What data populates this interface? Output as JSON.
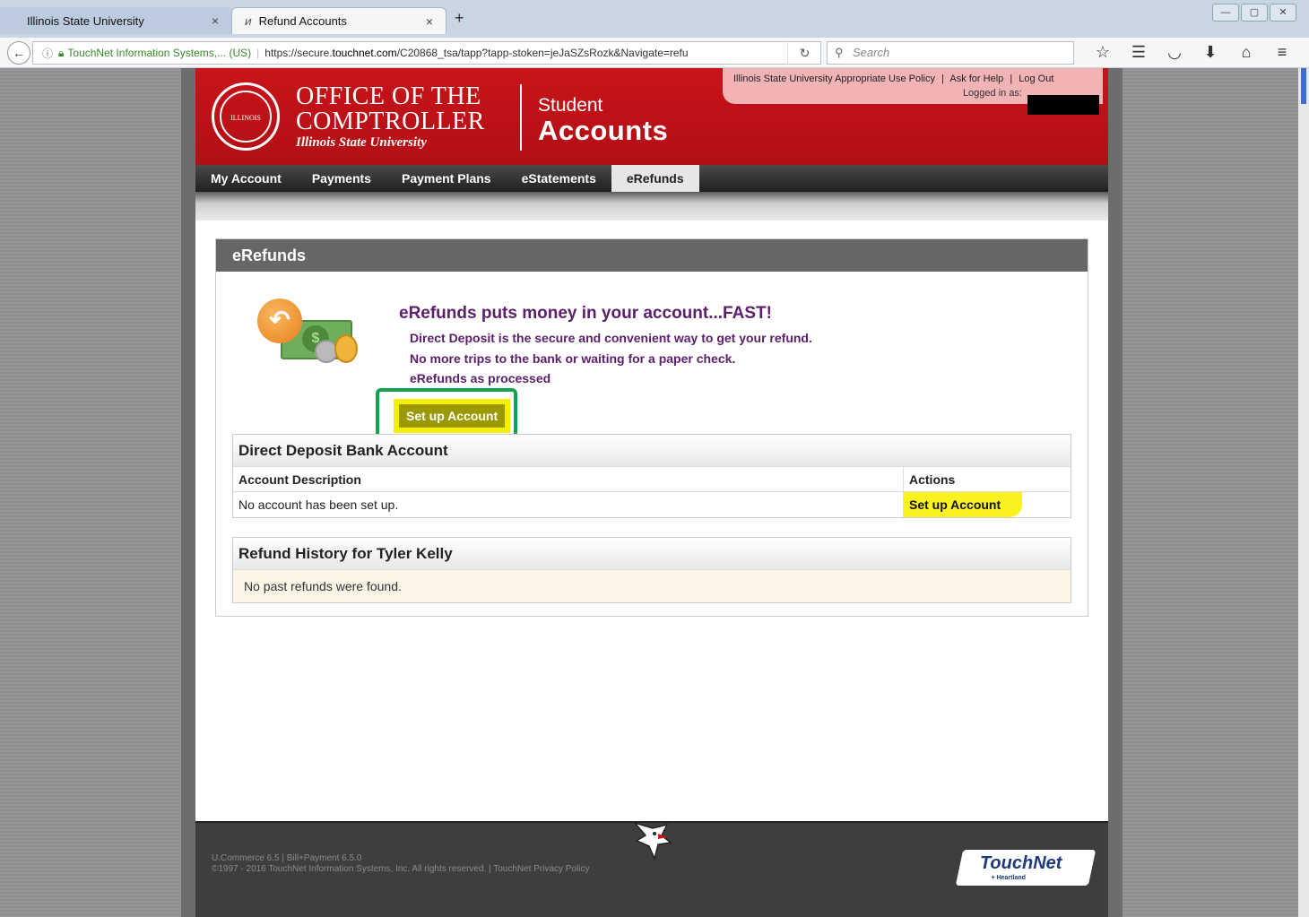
{
  "browser": {
    "tabs": [
      {
        "label": "Illinois State University",
        "active": false
      },
      {
        "label": "Refund Accounts",
        "active": true
      }
    ],
    "url_site": "TouchNet Information Systems,... (US)",
    "url_prefix": "https://secure.",
    "url_domain": "touchnet.com",
    "url_rest": "/C20868_tsa/tapp?tapp-stoken=jeJaSZsRozk&Navigate=refu",
    "search_placeholder": "Search"
  },
  "header": {
    "seal_text": "ILLINOIS STATE UNIVERSITY",
    "office_line1": "Office of the",
    "office_line2": "Comptroller",
    "office_line3": "Illinois State University",
    "student": "Student",
    "accounts": "Accounts",
    "links": [
      "Illinois State University Appropriate Use Policy",
      "Ask for Help",
      "Log Out"
    ],
    "logged_in": "Logged in as:"
  },
  "nav": {
    "items": [
      "My Account",
      "Payments",
      "Payment Plans",
      "eStatements",
      "eRefunds"
    ],
    "active": "eRefunds"
  },
  "panel": {
    "title": "eRefunds",
    "promo_title": "eRefunds puts money in your account...FAST!",
    "promo_lines": [
      "Direct Deposit is the secure and convenient way to get your refund.",
      "No more trips to the bank or waiting for a paper check.",
      "eRefunds as processed"
    ],
    "setup_button": "Set up Account"
  },
  "bank_account": {
    "title": "Direct Deposit Bank Account",
    "col_description": "Account Description",
    "col_actions": "Actions",
    "row_text": "No account has been set up.",
    "row_action": "Set up Account"
  },
  "history": {
    "title": "Refund History for Tyler Kelly",
    "empty_text": "No past refunds were found."
  },
  "footer": {
    "line1": "U.Commerce 6.5 | Bill+Payment 6.5.0",
    "line2": "©1997 - 2016  TouchNet Information Systems, Inc. All rights reserved.  |  TouchNet Privacy Policy",
    "logo": "TouchNet",
    "logo_sub": "+ Heartland"
  },
  "colors": {
    "header_red": "#c8141a",
    "promo_purple": "#5b1f6b",
    "highlight_yellow": "#f9f21e",
    "annotation_green": "#16a14e"
  }
}
